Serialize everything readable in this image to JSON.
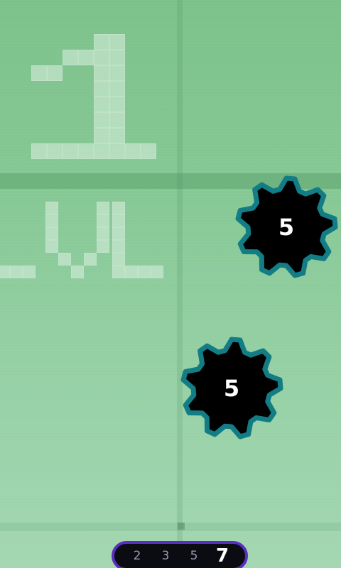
{
  "level_display": {
    "number": "1",
    "label": "LVL"
  },
  "gears": [
    {
      "value": "5"
    },
    {
      "value": "5"
    }
  ],
  "track": {
    "items": [
      "2",
      "3",
      "5",
      "7"
    ],
    "current_index": 3
  },
  "colors": {
    "background_top": "#7cc18a",
    "background_bottom": "#a3d6b1",
    "gear_fill": "#000000",
    "gear_outline": "#137d86",
    "gear_text": "#ffffff",
    "track_border": "#5a2ec0",
    "track_background": "#0b0b12"
  },
  "icons": {
    "gear": "gear-icon"
  }
}
